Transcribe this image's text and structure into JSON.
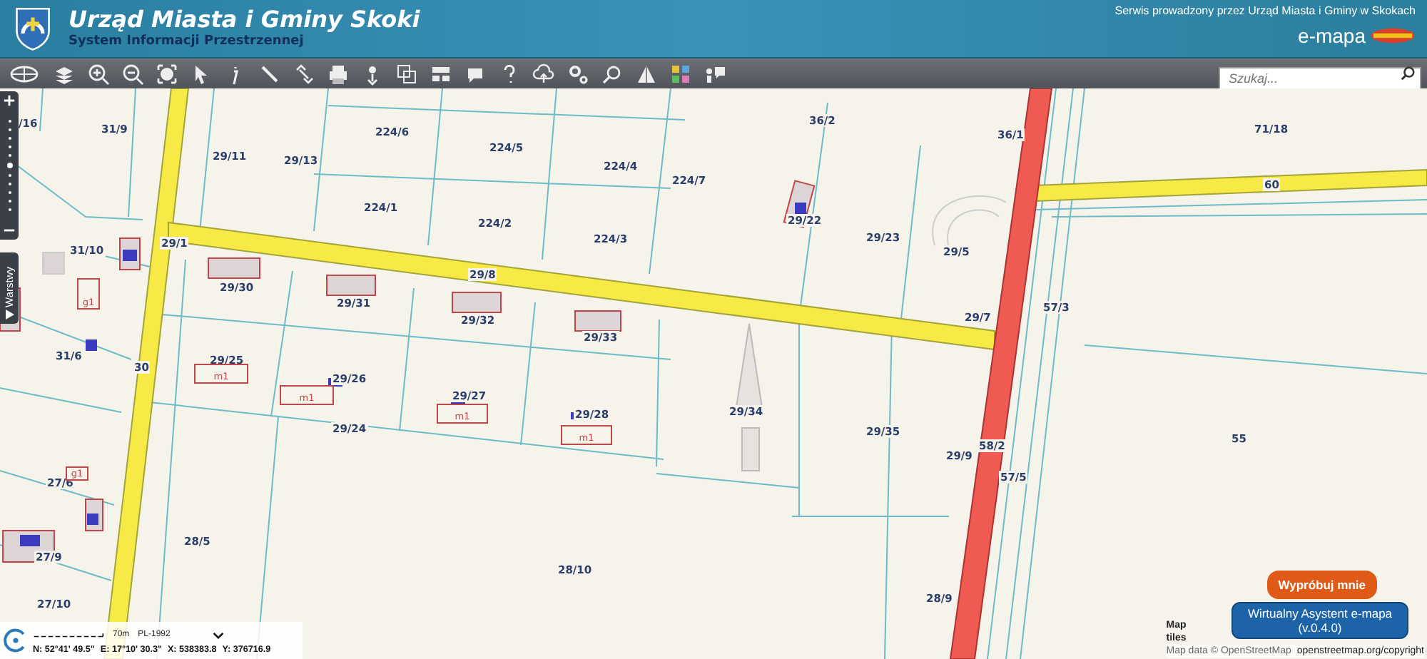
{
  "header": {
    "title": "Urząd Miasta i Gminy Skoki",
    "subtitle": "System Informacji Przestrzennej",
    "service_note": "Serwis prowadzony przez Urząd Miasta i Gminy w Skokach",
    "brand": "e-mapa"
  },
  "search": {
    "placeholder": "Szukaj..."
  },
  "map": {
    "layers_tab": "Warstwy",
    "parcels": [
      "/16",
      "31/9",
      "29/11",
      "29/13",
      "224/6",
      "224/5",
      "224/4",
      "224/7",
      "36/2",
      "36/1",
      "71/18",
      "60",
      "224/1",
      "224/2",
      "224/3",
      "29/22",
      "29/23",
      "29/5",
      "31/10",
      "29/1",
      "29/8",
      "29/30",
      "29/31",
      "29/32",
      "29/33",
      "29/7",
      "57/3",
      "31/6",
      "30",
      "29/25",
      "29/26",
      "29/27",
      "29/28",
      "29/34",
      "29/24",
      "29/35",
      "58/2",
      "57/5",
      "55",
      "29/9",
      "27/6",
      "28/5",
      "27/9",
      "28/10",
      "27/10",
      "28/9"
    ],
    "buildings": [
      "g1",
      "m1",
      "m1",
      "m1",
      "m1",
      "g1"
    ]
  },
  "scale": {
    "distance": "70m",
    "projection": "PL-1992"
  },
  "coordinates": {
    "n": "N: 52°41' 49.5\"",
    "e": "E: 17°10' 30.3\"",
    "x": "X: 538383.8",
    "y": "Y: 376716.9"
  },
  "assistant": {
    "prompt": "Wypróbuj mnie",
    "title": "Wirtualny Asystent e-mapa",
    "version": "(v.0.4.0)"
  },
  "attribution": {
    "tiles": "Map tiles",
    "data": "Map data © OpenStreetMap",
    "link": "openstreetmap.org/copyright"
  }
}
